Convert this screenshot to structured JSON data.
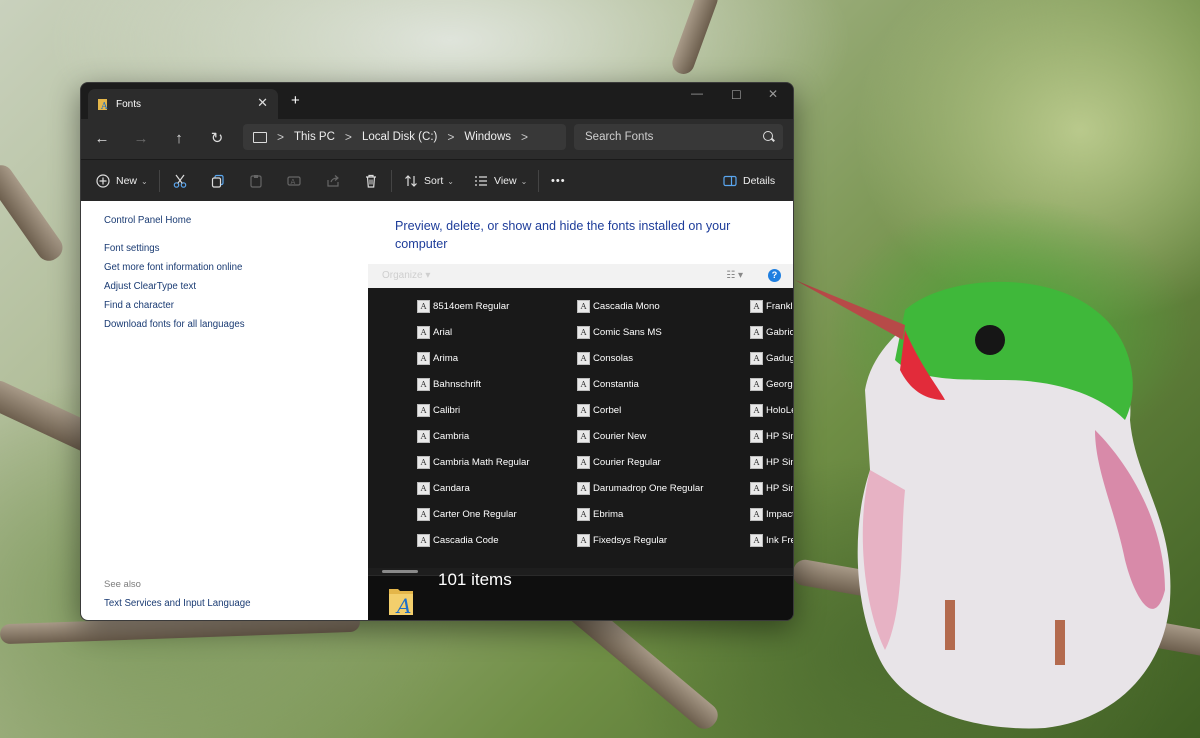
{
  "window": {
    "tab_title": "Fonts",
    "tab_close": "✕",
    "new_tab": "+",
    "minimize": "—",
    "maximize": "☐",
    "close": "✕"
  },
  "nav": {
    "back": "←",
    "forward": "→",
    "up": "↑",
    "refresh": "↻"
  },
  "address": {
    "segments": [
      "This PC",
      "Local Disk (C:)",
      "Windows"
    ],
    "sep": ">"
  },
  "search": {
    "placeholder": "Search Fonts"
  },
  "commandbar": {
    "new_label": "New",
    "sort_label": "Sort",
    "view_label": "View",
    "more_label": "•••",
    "details_label": "Details",
    "chev": "⌄"
  },
  "leftpane": {
    "control_panel_home": "Control Panel Home",
    "links": [
      "Font settings",
      "Get more font information online",
      "Adjust ClearType text",
      "Find a character",
      "Download fonts for all languages"
    ],
    "see_also": "See also",
    "see_also_link": "Text Services and Input Language"
  },
  "rightpane": {
    "description": "Preview, delete, or show and hide the fonts installed on your computer",
    "organize": "Organize ▾",
    "help": "?",
    "fonts_col1": [
      "8514oem Regular",
      "Arial",
      "Arima",
      "Bahnschrift",
      "Calibri",
      "Cambria",
      "Cambria Math Regular",
      "Candara",
      "Carter One Regular",
      "Cascadia Code"
    ],
    "fonts_col2": [
      "Cascadia Mono",
      "Comic Sans MS",
      "Consolas",
      "Constantia",
      "Corbel",
      "Courier New",
      "Courier Regular",
      "Darumadrop One Regular",
      "Ebrima",
      "Fixedsys Regular"
    ],
    "fonts_col3": [
      "Frankli",
      "Gabrio",
      "Gadug",
      "Georgi",
      "HoloLe",
      "HP Sim",
      "HP Sim",
      "HP Sim",
      "Impact",
      "Ink Free"
    ],
    "font_glyph": "A",
    "item_count": "101 items"
  }
}
